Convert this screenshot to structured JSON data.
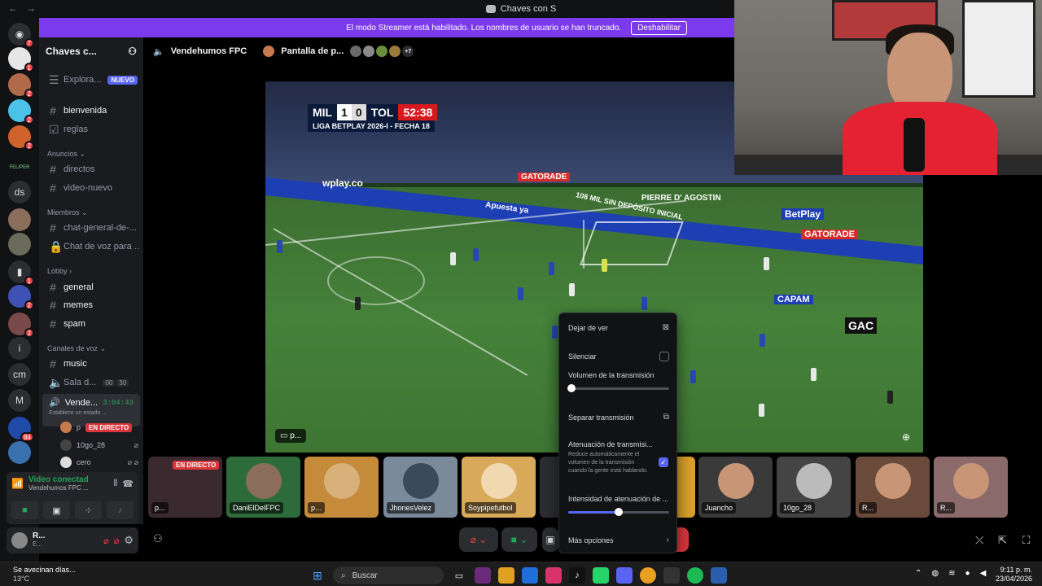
{
  "window": {
    "title": "Chaves con S",
    "back": "←",
    "forward": "→"
  },
  "banner": {
    "text": "El modo Streamer está habilitado. Los nombres de usuario se han truncado.",
    "button": "Deshabilitar"
  },
  "rail": {
    "badges": [
      "7",
      "1",
      "2",
      "2",
      "2",
      "1",
      "2",
      "2",
      "84"
    ],
    "letters": [
      "ds",
      "i",
      "cm",
      "M"
    ],
    "server_label": "FELIPER"
  },
  "sidebar": {
    "server_name": "Chaves c...",
    "explore": {
      "label": "Explora...",
      "badge": "NUEVO"
    },
    "channels_top": [
      "bienvenida",
      "reglas"
    ],
    "cat_anuncios": "Anuncios",
    "anuncios": [
      "directos",
      "video-nuevo"
    ],
    "cat_miembros": "Miembros",
    "miembros": [
      "chat-general-de-...",
      "Chat de voz para ..."
    ],
    "cat_lobby": "Lobby",
    "lobby": [
      "general",
      "memes",
      "spam"
    ],
    "cat_voz": "Canales de voz",
    "voz_music": "music",
    "sala": {
      "label": "Sala d...",
      "count_a": "00",
      "count_b": "30"
    },
    "active_voice": {
      "label": "Vende...",
      "time": "3:04:43",
      "sub": "Establece un estado ..."
    },
    "voice_users": [
      {
        "name": "p",
        "badge": "EN DIRECTO"
      },
      {
        "name": "10go_28"
      },
      {
        "name": "cero"
      }
    ]
  },
  "voice_panel": {
    "status": "Video conectad",
    "channel": "Vendehumos FPC ..."
  },
  "user_panel": {
    "name": "R...",
    "sub": "E..."
  },
  "topbar": {
    "channel": "Vendehumos FPC",
    "screen": "Pantalla de p...",
    "extra": "+7"
  },
  "stream": {
    "team_home": "MIL",
    "score_home": "1",
    "score_away": "0",
    "team_away": "TOL",
    "clock": "52:38",
    "league": "LIGA BETPLAY 2026-I - FECHA 18",
    "ads": [
      "wplay.co",
      "GATORADE",
      "PIERRE D' AGOSTIN",
      "BetPlay",
      "CAPAM",
      "GAC",
      "108 MIL SIN DEPÓSITO INICIAL",
      "Apuesta ya"
    ],
    "tag": "p..."
  },
  "tiles": [
    {
      "name": "p...",
      "live": "EN DIRECTO"
    },
    {
      "name": "DaniElDelFPC"
    },
    {
      "name": "p..."
    },
    {
      "name": "JhonesVelez"
    },
    {
      "name": "Soypipefutbol"
    },
    {
      "name": ""
    },
    {
      "name": ""
    },
    {
      "name": "Juancho"
    },
    {
      "name": "10go_28"
    },
    {
      "name": "R..."
    },
    {
      "name": "R..."
    }
  ],
  "menu": {
    "stop": "Dejar de ver",
    "mute": "Silenciar",
    "volume": "Volumen de la transmisión",
    "volume_level": 0.03,
    "popout": "Separar transmisión",
    "attenuation": "Atenuación de transmisi...",
    "attenuation_desc": "Reduce automáticamente el volumen de la transmisión cuando la gente está hablando.",
    "intensity": "Intensidad de atenuación de ...",
    "intensity_level": 0.5,
    "more": "Más opciones"
  },
  "taskbar": {
    "weather_title": "Se avecinan días...",
    "weather_temp": "13°C",
    "search": "Buscar",
    "time": "9:11 p. m.",
    "date": "23/04/2026"
  },
  "colors": {
    "accent": "#5865f2",
    "banner": "#7c3aed",
    "live": "#da373c",
    "online": "#23a55a"
  }
}
